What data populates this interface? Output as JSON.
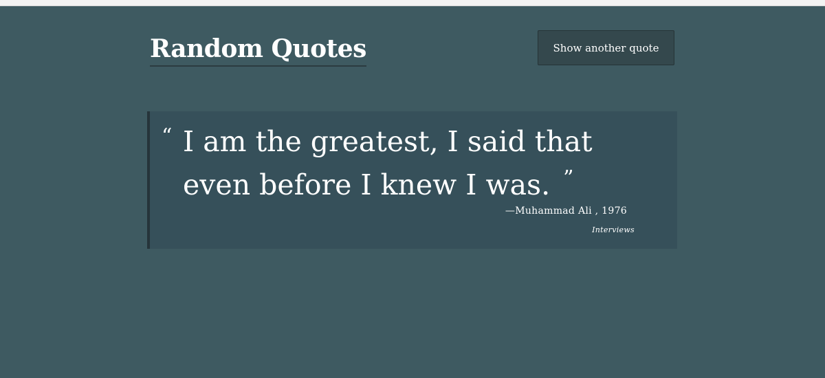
{
  "header": {
    "title": "Random Quotes",
    "button_label": "Show another quote"
  },
  "quote": {
    "open_mark": "“",
    "text": "I am the greatest, I said that even before I knew I was.",
    "close_mark": "”",
    "attribution": "—Muhammad Ali , 1976",
    "source": "Interviews"
  },
  "colors": {
    "background": "#3e5a61",
    "card": "#36505a",
    "card_border": "#26343a",
    "button": "#34484d",
    "text": "#ffffff"
  }
}
